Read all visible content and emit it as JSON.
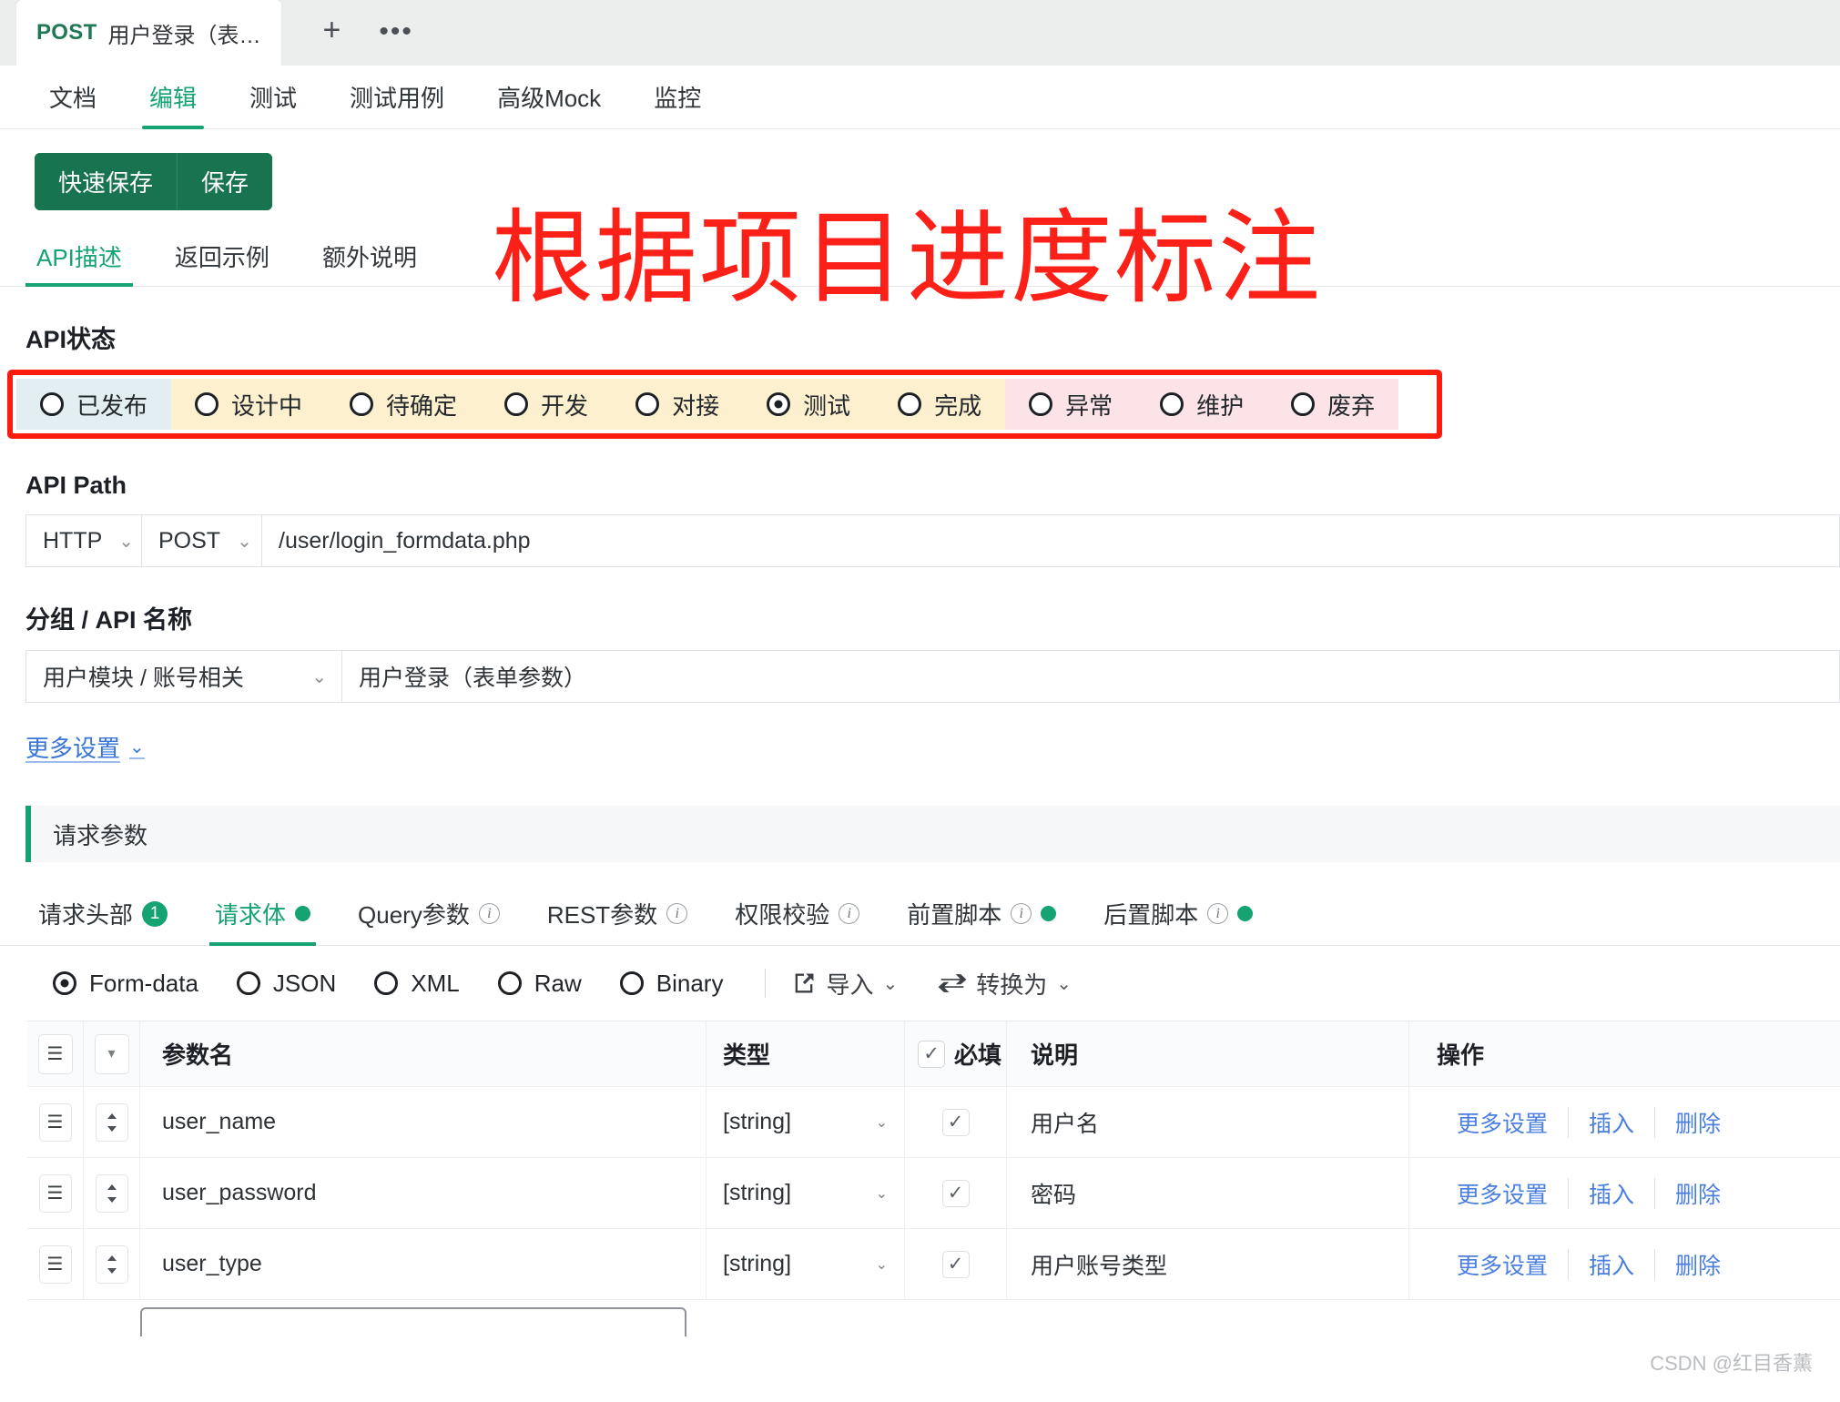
{
  "tabstrip": {
    "tab": {
      "method": "POST",
      "title": "用户登录（表…"
    },
    "new_tab_icon": "+",
    "more_icon": "•••"
  },
  "mainnav": {
    "items": [
      {
        "label": "文档",
        "active": false
      },
      {
        "label": "编辑",
        "active": true
      },
      {
        "label": "测试",
        "active": false
      },
      {
        "label": "测试用例",
        "active": false
      },
      {
        "label": "高级Mock",
        "active": false
      },
      {
        "label": "监控",
        "active": false
      }
    ]
  },
  "toolbar": {
    "quick_save_label": "快速保存",
    "save_label": "保存",
    "button_color": "#18734f"
  },
  "subtabs": {
    "items": [
      {
        "label": "API描述",
        "active": true
      },
      {
        "label": "返回示例",
        "active": false
      },
      {
        "label": "额外说明",
        "active": false
      }
    ]
  },
  "annotation": {
    "text": "根据项目进度标注",
    "color": "#fc2118"
  },
  "api_status": {
    "label": "API状态",
    "highlight_color": "#fc1b0f",
    "selected": "测试",
    "options": [
      {
        "label": "已发布",
        "segment": "blue",
        "checked": false
      },
      {
        "label": "设计中",
        "segment": "amber",
        "checked": false
      },
      {
        "label": "待确定",
        "segment": "amber",
        "checked": false
      },
      {
        "label": "开发",
        "segment": "amber",
        "checked": false
      },
      {
        "label": "对接",
        "segment": "amber",
        "checked": false
      },
      {
        "label": "测试",
        "segment": "amber",
        "checked": true
      },
      {
        "label": "完成",
        "segment": "amber",
        "checked": false
      },
      {
        "label": "异常",
        "segment": "pink",
        "checked": false
      },
      {
        "label": "维护",
        "segment": "pink",
        "checked": false
      },
      {
        "label": "废弃",
        "segment": "pink",
        "checked": false
      }
    ]
  },
  "api_path": {
    "label": "API Path",
    "protocol": "HTTP",
    "method": "POST",
    "path": "/user/login_formdata.php"
  },
  "api_name": {
    "label": "分组 / API 名称",
    "group": "用户模块 / 账号相关",
    "name": "用户登录（表单参数）"
  },
  "more_settings": {
    "label": "更多设置",
    "caret": "⌄"
  },
  "request_params": {
    "banner": "请求参数",
    "tabs": [
      {
        "label": "请求头部",
        "badge": "1",
        "info": false,
        "dot": false,
        "active": false
      },
      {
        "label": "请求体",
        "badge": null,
        "info": false,
        "dot": true,
        "active": true
      },
      {
        "label": "Query参数",
        "badge": null,
        "info": true,
        "dot": false,
        "active": false
      },
      {
        "label": "REST参数",
        "badge": null,
        "info": true,
        "dot": false,
        "active": false
      },
      {
        "label": "权限校验",
        "badge": null,
        "info": true,
        "dot": false,
        "active": false
      },
      {
        "label": "前置脚本",
        "badge": null,
        "info": true,
        "dot": true,
        "active": false
      },
      {
        "label": "后置脚本",
        "badge": null,
        "info": true,
        "dot": true,
        "active": false
      }
    ]
  },
  "body_type": {
    "selected": "Form-data",
    "options": [
      "Form-data",
      "JSON",
      "XML",
      "Raw",
      "Binary"
    ],
    "import_label": "导入",
    "convert_label": "转换为"
  },
  "param_table": {
    "columns": [
      "参数名",
      "类型",
      "必填",
      "说明",
      "操作"
    ],
    "header_required_checked": true,
    "actions": [
      "更多设置",
      "插入",
      "删除"
    ],
    "rows": [
      {
        "name": "user_name",
        "type": "[string]",
        "required": true,
        "desc": "用户名"
      },
      {
        "name": "user_password",
        "type": "[string]",
        "required": true,
        "desc": "密码"
      },
      {
        "name": "user_type",
        "type": "[string]",
        "required": true,
        "desc": "用户账号类型"
      }
    ]
  },
  "watermark": {
    "text": "CSDN @红目香薰"
  }
}
